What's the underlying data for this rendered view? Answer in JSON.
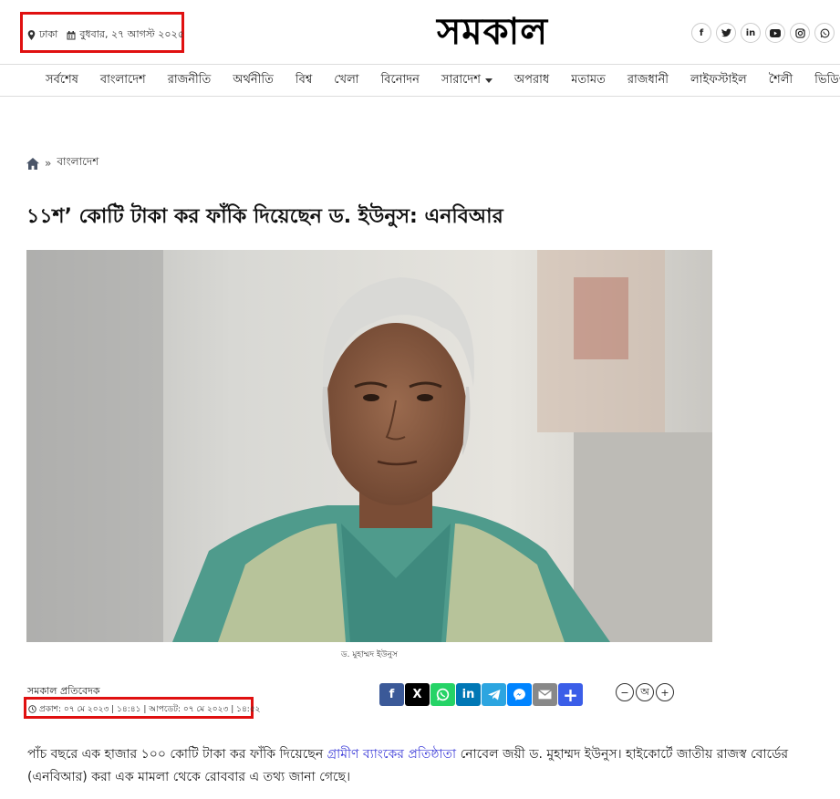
{
  "header": {
    "location": "ঢাকা",
    "date": "বুধবার, ২৭ আগস্ট ২০২৫",
    "logo_text": "সমকাল",
    "socials": [
      "f",
      "t",
      "in",
      "yt",
      "ig",
      "wa"
    ]
  },
  "nav": {
    "items": [
      "সর্বশেষ",
      "বাংলাদেশ",
      "রাজনীতি",
      "অর্থনীতি",
      "বিশ্ব",
      "খেলা",
      "বিনোদন",
      "সারাদেশ",
      "অপরাধ",
      "মতামত",
      "রাজধানী",
      "লাইফস্টাইল",
      "শৈলী",
      "ভিডিও"
    ]
  },
  "breadcrumb": {
    "section": "বাংলাদেশ"
  },
  "article": {
    "headline": "১১শ’ কোটি টাকা কর ফাঁকি দিয়েছেন ড. ইউনুস: এনবিআর",
    "caption": "ড. মুহাম্মদ ইউনুস",
    "byline": "সমকাল প্রতিবেদক",
    "dates": "প্রকাশ: ০৭ মে ২০২৩ | ১৪:৪১ | আপডেট: ০৭ মে ২০২৩ | ১৪:৫২",
    "body_part1": "পাঁচ বছরে এক হাজার ১০০ কোটি টাকা কর ফাঁকি দিয়েছেন ",
    "body_link": "গ্রামীণ ব্যাংকের প্রতিষ্ঠাতা",
    "body_part2": " নোবেল জয়ী ড. মুহাম্মদ ইউনুস। হাইকোর্টে জাতীয় রাজস্ব বোর্ডের (এনবিআর) করা এক মামলা থেকে রোববার এ তথ্য জানা গেছে।"
  },
  "share": {
    "buttons": [
      {
        "name": "facebook",
        "glyph": "f",
        "color": "#3b5998"
      },
      {
        "name": "x",
        "glyph": "X",
        "color": "#000000"
      },
      {
        "name": "whatsapp",
        "glyph": "w",
        "color": "#25d366"
      },
      {
        "name": "linkedin",
        "glyph": "in",
        "color": "#0077b5"
      },
      {
        "name": "telegram",
        "glyph": "➤",
        "color": "#2ca5e0"
      },
      {
        "name": "messenger",
        "glyph": "m",
        "color": "#0084ff"
      },
      {
        "name": "email",
        "glyph": "✉",
        "color": "#888888"
      },
      {
        "name": "more",
        "glyph": "+",
        "color": "#3b5ee8"
      }
    ]
  },
  "font_controls": [
    "−",
    "অ",
    "+"
  ]
}
